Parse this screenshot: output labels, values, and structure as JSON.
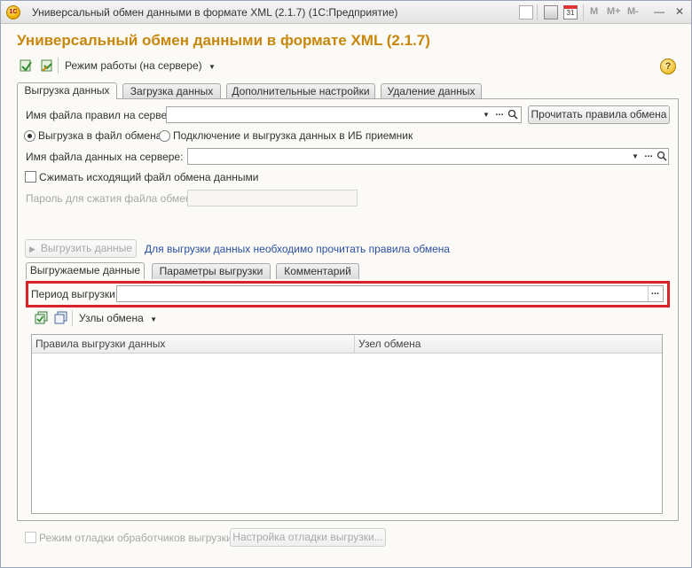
{
  "window": {
    "title": "Универсальный обмен данными в формате XML (2.1.7)  (1С:Предприятие)",
    "app_icon": "1С",
    "toolbar_labels": {
      "m": "M",
      "m_plus": "M+",
      "m_minus": "M-"
    },
    "buttons": {
      "minimize": "—",
      "restore": "□",
      "close": "✕"
    }
  },
  "form": {
    "title": "Универсальный обмен данными в формате XML (2.1.7)",
    "mode_button": "Режим работы (на сервере)",
    "help": "?"
  },
  "tabs": [
    {
      "label": "Выгрузка данных",
      "active": true
    },
    {
      "label": "Загрузка данных",
      "active": false
    },
    {
      "label": "Дополнительные настройки",
      "active": false
    },
    {
      "label": "Удаление данных",
      "active": false
    }
  ],
  "export": {
    "rules_file_label": "Имя файла правил на сервере:",
    "rules_file_value": "",
    "read_rules_button": "Прочитать правила обмена",
    "radio_file": "Выгрузка в файл обмена",
    "radio_connect": "Подключение и выгрузка данных в ИБ приемник",
    "data_file_label": "Имя файла данных на сервере:",
    "data_file_value": "",
    "compress_label": "Сжимать исходящий файл обмена данными",
    "password_label": "Пароль для сжатия файла обмена:",
    "password_value": "",
    "export_button": "Выгрузить данные",
    "hint_link": "Для выгрузки данных необходимо прочитать правила обмена"
  },
  "inner_tabs": [
    {
      "label": "Выгружаемые данные",
      "active": true
    },
    {
      "label": "Параметры выгрузки",
      "active": false
    },
    {
      "label": "Комментарий",
      "active": false
    }
  ],
  "period": {
    "label": "Период выгрузки:",
    "value": "",
    "ellipsis": "..."
  },
  "nodes_toolbar": {
    "nodes_button": "Узлы обмена"
  },
  "table": {
    "columns": [
      "Правила выгрузки данных",
      "Узел обмена"
    ],
    "rows": []
  },
  "footer": {
    "debug_label": "Режим отладки обработчиков выгрузки",
    "debug_settings_button": "Настройка отладки выгрузки..."
  },
  "colors": {
    "title_accent": "#c8860a",
    "highlight": "#d8222a",
    "link": "#2a4fa0"
  }
}
